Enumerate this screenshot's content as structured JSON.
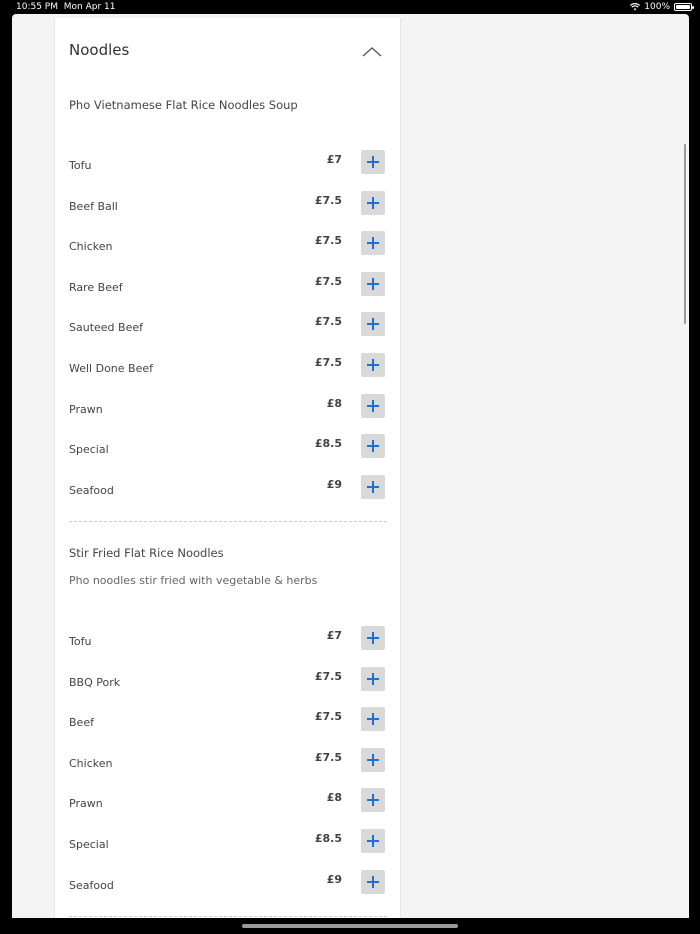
{
  "status_bar": {
    "time": "10:55 PM",
    "date": "Mon Apr 11",
    "battery": "100%"
  },
  "section": {
    "title": "Noodles"
  },
  "groups": [
    {
      "title": "Pho Vietnamese Flat Rice Noodles Soup",
      "description": "",
      "items": [
        {
          "name": "Tofu",
          "price": "£7"
        },
        {
          "name": "Beef Ball",
          "price": "£7.5"
        },
        {
          "name": "Chicken",
          "price": "£7.5"
        },
        {
          "name": "Rare Beef",
          "price": "£7.5"
        },
        {
          "name": "Sauteed Beef",
          "price": "£7.5"
        },
        {
          "name": "Well Done Beef",
          "price": "£7.5"
        },
        {
          "name": "Prawn",
          "price": "£8"
        },
        {
          "name": "Special",
          "price": "£8.5"
        },
        {
          "name": "Seafood",
          "price": "£9"
        }
      ]
    },
    {
      "title": "Stir Fried Flat Rice Noodles",
      "description": "Pho noodles stir fried with vegetable & herbs",
      "items": [
        {
          "name": "Tofu",
          "price": "£7"
        },
        {
          "name": "BBQ Pork",
          "price": "£7.5"
        },
        {
          "name": "Beef",
          "price": "£7.5"
        },
        {
          "name": "Chicken",
          "price": "£7.5"
        },
        {
          "name": "Prawn",
          "price": "£8"
        },
        {
          "name": "Special",
          "price": "£8.5"
        },
        {
          "name": "Seafood",
          "price": "£9"
        }
      ]
    }
  ],
  "colors": {
    "accent": "#1f6fd4",
    "button_bg": "#d9d9d9"
  },
  "icons": {
    "collapse": "chevron-up-icon",
    "add": "plus-icon"
  }
}
